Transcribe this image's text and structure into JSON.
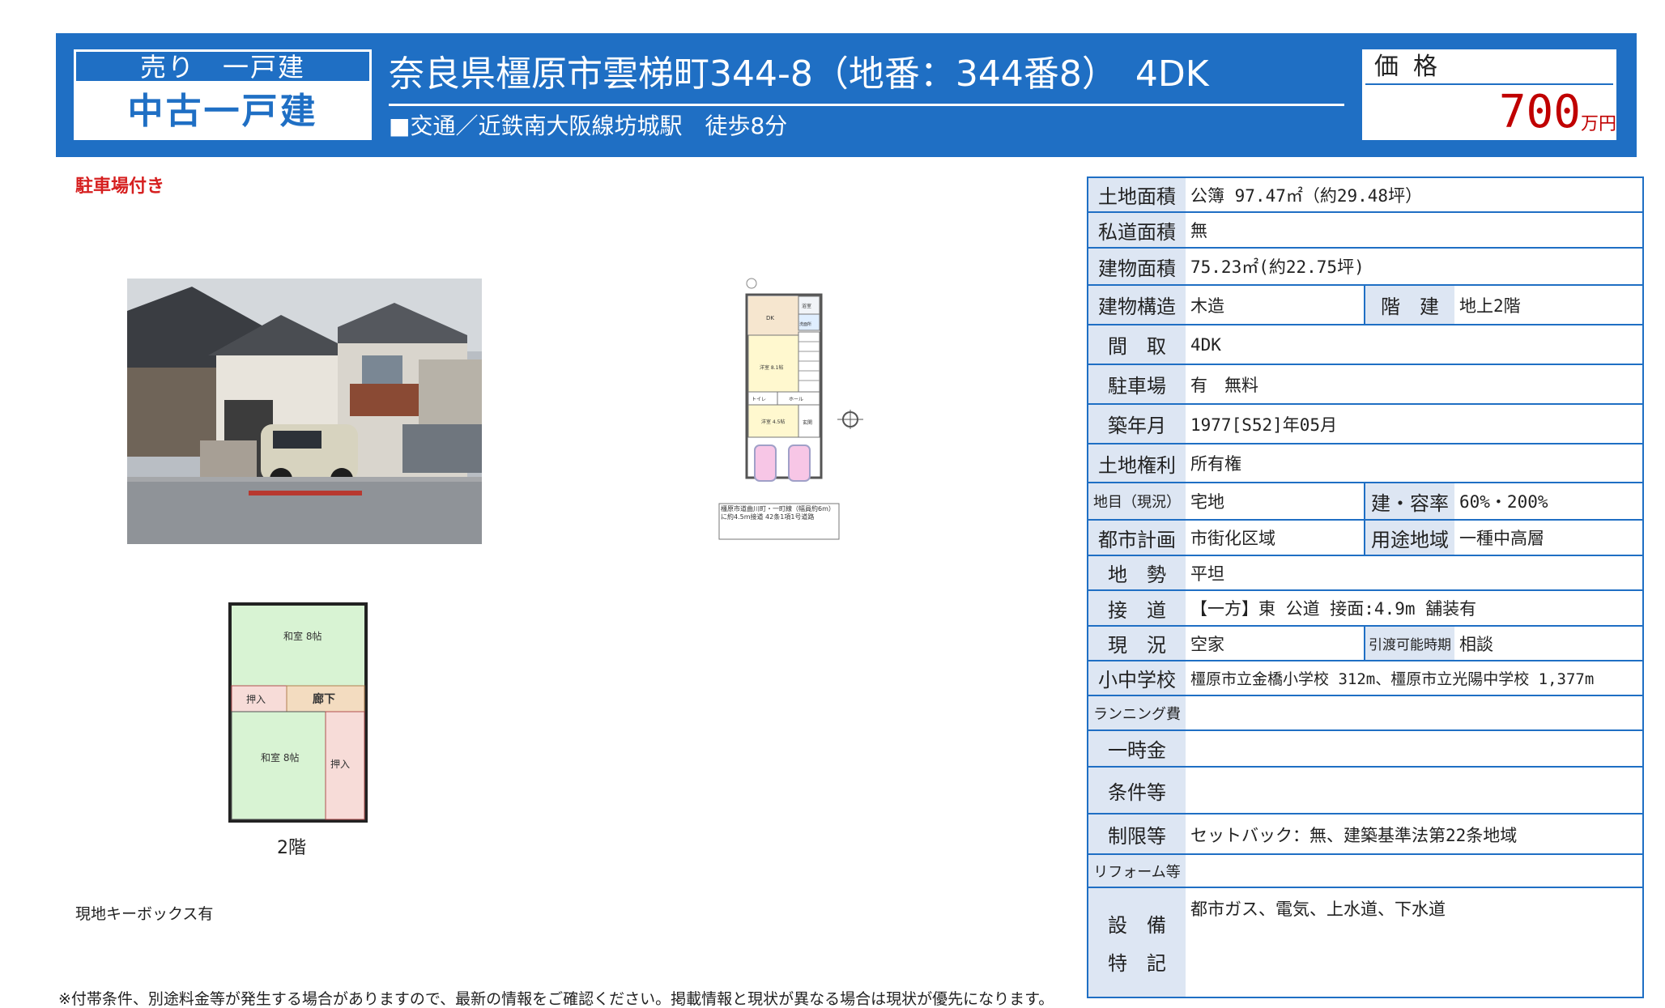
{
  "header": {
    "sale_type": "売り　一戸建",
    "property_type": "中古一戸建",
    "address_title": "奈良県橿原市雲梯町344-8（地番：344番8）　4DK",
    "access": "■交通／近鉄南大阪線坊城駅　徒歩8分",
    "price_label": "価格",
    "price_value": "700",
    "price_unit": "万円"
  },
  "notes": {
    "parking": "駐車場付き",
    "keybox": "現地キーボックス有",
    "footer": "※付帯条件、別途料金等が発生する場合がありますので、最新の情報をご確認ください。掲載情報と現状が異なる場合は現状が優先になります。"
  },
  "floor_plan_1f": {
    "rooms": [
      "DK",
      "浴室",
      "洗面所",
      "洋室 8.1帖",
      "トイレ",
      "ホール",
      "洋室 4.5帖",
      "玄関"
    ],
    "road_note": "橿原市道曲川町・一町線（幅員約6m）に約4.5m接道 42条1項1号道路"
  },
  "floor_plan_2f": {
    "rooms": [
      "和室 8帖",
      "押入",
      "廊下",
      "和室 8帖",
      "押入"
    ],
    "label": "2階"
  },
  "specs": {
    "land_area": {
      "label": "土地面積",
      "value": "公簿 97.47㎡（約29.48坪）"
    },
    "private_road": {
      "label": "私道面積",
      "value": "無"
    },
    "building_area": {
      "label": "建物面積",
      "value": "75.23㎡(約22.75坪)"
    },
    "structure": {
      "label": "建物構造",
      "value": "木造",
      "label2": "階　建",
      "value2": "地上2階"
    },
    "layout": {
      "label": "間　取",
      "value": "4DK"
    },
    "parking": {
      "label": "駐車場",
      "value": "有　無料"
    },
    "built": {
      "label": "築年月",
      "value": "1977[S52]年05月"
    },
    "land_rights": {
      "label": "土地権利",
      "value": "所有権"
    },
    "land_category": {
      "label": "地目（現況）",
      "value": "宅地",
      "label2": "建・容率",
      "value2": "60%・200%"
    },
    "city_planning": {
      "label": "都市計画",
      "value": "市街化区域",
      "label2": "用途地域",
      "value2": "一種中高層"
    },
    "terrain": {
      "label": "地　勢",
      "value": "平坦"
    },
    "road_access": {
      "label": "接　道",
      "value": "【一方】東 公道 接面:4.9m 舗装有"
    },
    "status": {
      "label": "現　況",
      "value": "空家",
      "label2": "引渡可能時期",
      "value2": "相談"
    },
    "schools": {
      "label": "小中学校",
      "value": "橿原市立金橋小学校 312m、橿原市立光陽中学校 1,377m"
    },
    "running_cost": {
      "label": "ランニング費",
      "value": ""
    },
    "lump_sum": {
      "label": "一時金",
      "value": ""
    },
    "conditions": {
      "label": "条件等",
      "value": ""
    },
    "restrictions": {
      "label": "制限等",
      "value": "セットバック：無、建築基準法第22条地域"
    },
    "reform": {
      "label": "リフォーム等",
      "value": ""
    },
    "facilities": {
      "label_1": "設　備",
      "label_2": "特　記",
      "value": "都市ガス、電気、上水道、下水道"
    }
  },
  "colors": {
    "brand_blue": "#1f6fc4",
    "price_red": "#c00000",
    "note_red": "#d62020",
    "label_bg": "#dde6f3"
  }
}
